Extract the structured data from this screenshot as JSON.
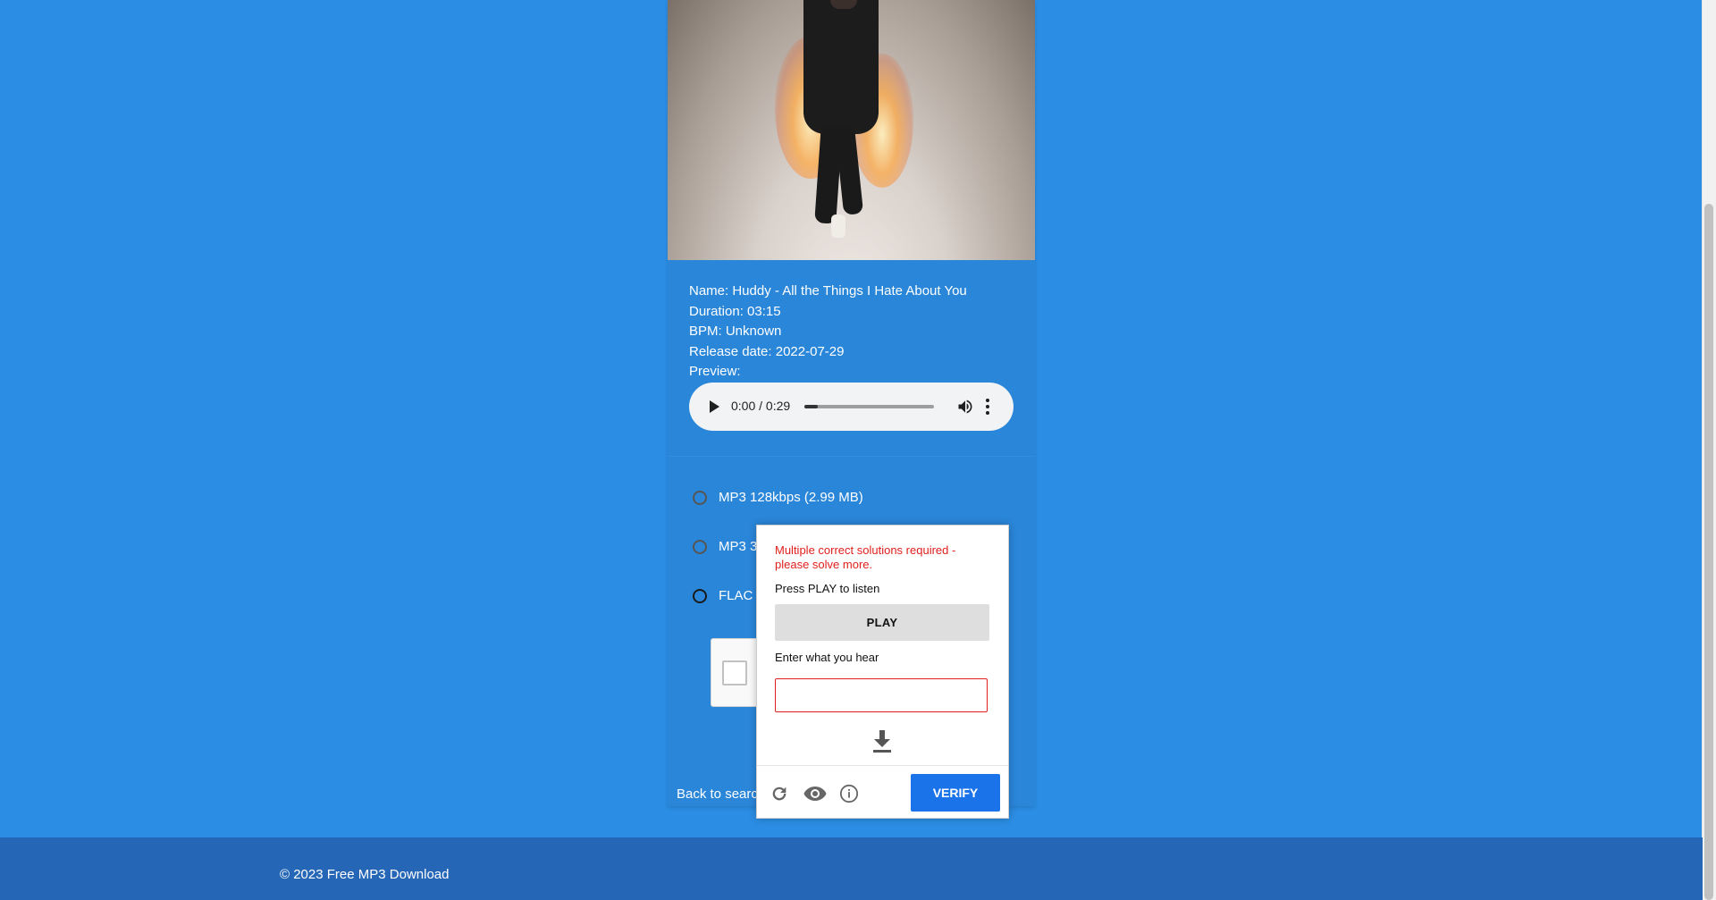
{
  "track": {
    "name": "Name: Huddy - All the Things I Hate About You",
    "duration": "Duration: 03:15",
    "bpm": "BPM: Unknown",
    "release_date": "Release date: 2022-07-29",
    "preview_label": "Preview:"
  },
  "player": {
    "time": "0:00 / 0:29",
    "progress_fraction": 0.1
  },
  "formats": [
    {
      "label": "MP3 128kbps (2.99 MB)"
    },
    {
      "label": "MP3 3"
    },
    {
      "label": "FLAC ("
    }
  ],
  "back_link": "Back to searc",
  "captcha": {
    "error": "Multiple correct solutions required - please solve more.",
    "instruction": "Press PLAY to listen",
    "play_label": "PLAY",
    "enter_label": "Enter what you hear",
    "answer_value": "",
    "verify_label": "VERIFY",
    "icons": [
      "download-icon",
      "reload-icon",
      "visual-challenge-icon",
      "info-icon"
    ]
  },
  "footer": {
    "copyright": "© 2023 Free MP3 Download"
  },
  "colors": {
    "page_bg": "#2b8de3",
    "card_bg": "#2a86d9",
    "footer_bg": "#2566b7",
    "verify": "#1a73e8",
    "error": "#e0201c"
  }
}
